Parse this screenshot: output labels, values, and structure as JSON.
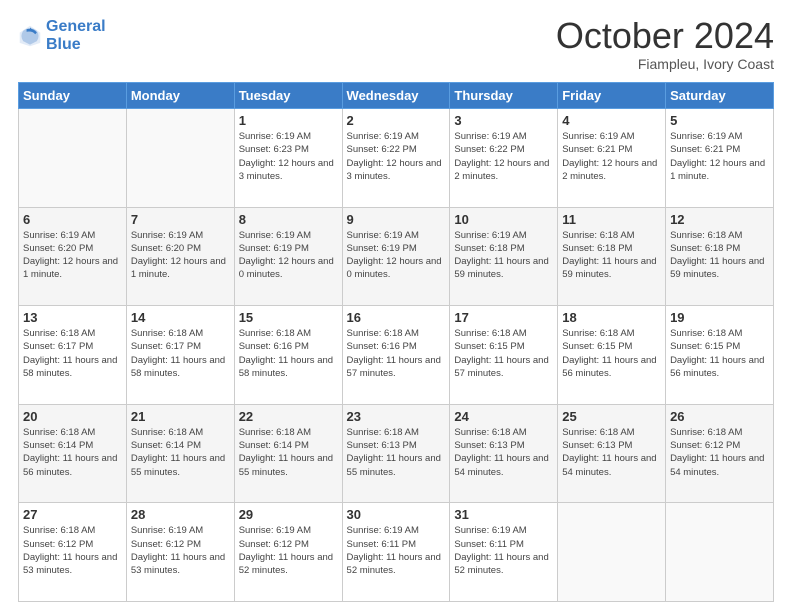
{
  "logo": {
    "line1": "General",
    "line2": "Blue"
  },
  "title": "October 2024",
  "subtitle": "Fiampleu, Ivory Coast",
  "days_header": [
    "Sunday",
    "Monday",
    "Tuesday",
    "Wednesday",
    "Thursday",
    "Friday",
    "Saturday"
  ],
  "weeks": [
    [
      {
        "day": "",
        "info": ""
      },
      {
        "day": "",
        "info": ""
      },
      {
        "day": "1",
        "info": "Sunrise: 6:19 AM\nSunset: 6:23 PM\nDaylight: 12 hours and 3 minutes."
      },
      {
        "day": "2",
        "info": "Sunrise: 6:19 AM\nSunset: 6:22 PM\nDaylight: 12 hours and 3 minutes."
      },
      {
        "day": "3",
        "info": "Sunrise: 6:19 AM\nSunset: 6:22 PM\nDaylight: 12 hours and 2 minutes."
      },
      {
        "day": "4",
        "info": "Sunrise: 6:19 AM\nSunset: 6:21 PM\nDaylight: 12 hours and 2 minutes."
      },
      {
        "day": "5",
        "info": "Sunrise: 6:19 AM\nSunset: 6:21 PM\nDaylight: 12 hours and 1 minute."
      }
    ],
    [
      {
        "day": "6",
        "info": "Sunrise: 6:19 AM\nSunset: 6:20 PM\nDaylight: 12 hours and 1 minute."
      },
      {
        "day": "7",
        "info": "Sunrise: 6:19 AM\nSunset: 6:20 PM\nDaylight: 12 hours and 1 minute."
      },
      {
        "day": "8",
        "info": "Sunrise: 6:19 AM\nSunset: 6:19 PM\nDaylight: 12 hours and 0 minutes."
      },
      {
        "day": "9",
        "info": "Sunrise: 6:19 AM\nSunset: 6:19 PM\nDaylight: 12 hours and 0 minutes."
      },
      {
        "day": "10",
        "info": "Sunrise: 6:19 AM\nSunset: 6:18 PM\nDaylight: 11 hours and 59 minutes."
      },
      {
        "day": "11",
        "info": "Sunrise: 6:18 AM\nSunset: 6:18 PM\nDaylight: 11 hours and 59 minutes."
      },
      {
        "day": "12",
        "info": "Sunrise: 6:18 AM\nSunset: 6:18 PM\nDaylight: 11 hours and 59 minutes."
      }
    ],
    [
      {
        "day": "13",
        "info": "Sunrise: 6:18 AM\nSunset: 6:17 PM\nDaylight: 11 hours and 58 minutes."
      },
      {
        "day": "14",
        "info": "Sunrise: 6:18 AM\nSunset: 6:17 PM\nDaylight: 11 hours and 58 minutes."
      },
      {
        "day": "15",
        "info": "Sunrise: 6:18 AM\nSunset: 6:16 PM\nDaylight: 11 hours and 58 minutes."
      },
      {
        "day": "16",
        "info": "Sunrise: 6:18 AM\nSunset: 6:16 PM\nDaylight: 11 hours and 57 minutes."
      },
      {
        "day": "17",
        "info": "Sunrise: 6:18 AM\nSunset: 6:15 PM\nDaylight: 11 hours and 57 minutes."
      },
      {
        "day": "18",
        "info": "Sunrise: 6:18 AM\nSunset: 6:15 PM\nDaylight: 11 hours and 56 minutes."
      },
      {
        "day": "19",
        "info": "Sunrise: 6:18 AM\nSunset: 6:15 PM\nDaylight: 11 hours and 56 minutes."
      }
    ],
    [
      {
        "day": "20",
        "info": "Sunrise: 6:18 AM\nSunset: 6:14 PM\nDaylight: 11 hours and 56 minutes."
      },
      {
        "day": "21",
        "info": "Sunrise: 6:18 AM\nSunset: 6:14 PM\nDaylight: 11 hours and 55 minutes."
      },
      {
        "day": "22",
        "info": "Sunrise: 6:18 AM\nSunset: 6:14 PM\nDaylight: 11 hours and 55 minutes."
      },
      {
        "day": "23",
        "info": "Sunrise: 6:18 AM\nSunset: 6:13 PM\nDaylight: 11 hours and 55 minutes."
      },
      {
        "day": "24",
        "info": "Sunrise: 6:18 AM\nSunset: 6:13 PM\nDaylight: 11 hours and 54 minutes."
      },
      {
        "day": "25",
        "info": "Sunrise: 6:18 AM\nSunset: 6:13 PM\nDaylight: 11 hours and 54 minutes."
      },
      {
        "day": "26",
        "info": "Sunrise: 6:18 AM\nSunset: 6:12 PM\nDaylight: 11 hours and 54 minutes."
      }
    ],
    [
      {
        "day": "27",
        "info": "Sunrise: 6:18 AM\nSunset: 6:12 PM\nDaylight: 11 hours and 53 minutes."
      },
      {
        "day": "28",
        "info": "Sunrise: 6:19 AM\nSunset: 6:12 PM\nDaylight: 11 hours and 53 minutes."
      },
      {
        "day": "29",
        "info": "Sunrise: 6:19 AM\nSunset: 6:12 PM\nDaylight: 11 hours and 52 minutes."
      },
      {
        "day": "30",
        "info": "Sunrise: 6:19 AM\nSunset: 6:11 PM\nDaylight: 11 hours and 52 minutes."
      },
      {
        "day": "31",
        "info": "Sunrise: 6:19 AM\nSunset: 6:11 PM\nDaylight: 11 hours and 52 minutes."
      },
      {
        "day": "",
        "info": ""
      },
      {
        "day": "",
        "info": ""
      }
    ]
  ]
}
